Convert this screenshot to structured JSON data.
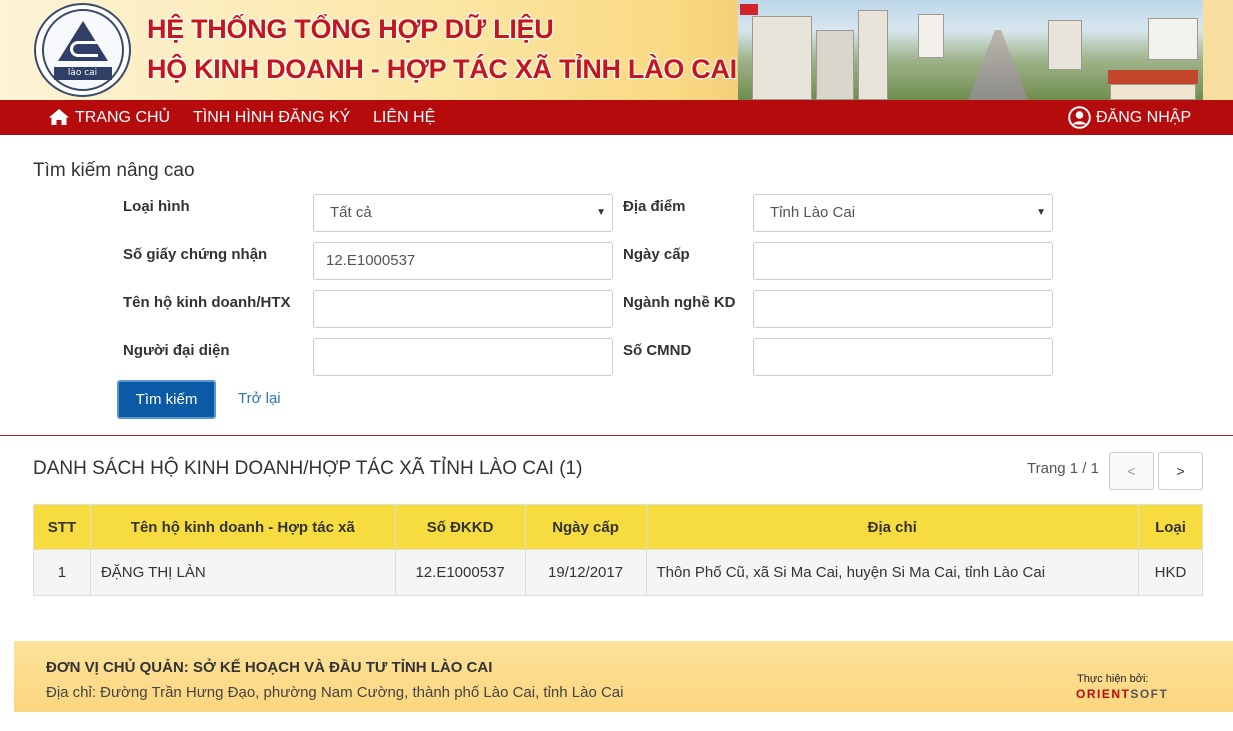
{
  "header": {
    "title_line1": "HỆ THỐNG TỔNG HỢP DỮ LIỆU",
    "title_line2": "HỘ KINH DOANH - HỢP TÁC XÃ TỈNH LÀO CAI",
    "logo_text": "lào cai"
  },
  "nav": {
    "home": "TRANG CHỦ",
    "registration": "TÌNH HÌNH ĐĂNG KÝ",
    "contact": "LIÊN HỆ",
    "login": "ĐĂNG NHẬP"
  },
  "search": {
    "title": "Tìm kiếm nâng cao",
    "type_label": "Loại hình",
    "type_value": "Tất cả",
    "location_label": "Địa điểm",
    "location_value": "Tỉnh Lào Cai",
    "cert_label": "Số giấy chứng nhận",
    "cert_value": "12.E1000537",
    "issue_date_label": "Ngày cấp",
    "issue_date_value": "",
    "name_label": "Tên hộ kinh doanh/HTX",
    "name_value": "",
    "industry_label": "Ngành nghề KD",
    "industry_value": "",
    "rep_label": "Người đại diện",
    "rep_value": "",
    "id_label": "Số CMND",
    "id_value": "",
    "search_button": "Tìm kiếm",
    "back_link": "Trở lại"
  },
  "list": {
    "title": "DANH SÁCH HỘ KINH DOANH/HỢP TÁC XÃ TỈNH LÀO CAI (1)",
    "page_info": "Trang 1 / 1",
    "prev": "<",
    "next": ">",
    "columns": [
      "STT",
      "Tên hộ kinh doanh - Hợp tác xã",
      "Số ĐKKD",
      "Ngày cấp",
      "Địa chỉ",
      "Loại"
    ],
    "rows": [
      [
        "1",
        "ĐẶNG THỊ LÀN",
        "12.E1000537",
        "19/12/2017",
        "Thôn Phố Cũ, xã Si Ma Cai, huyện Si Ma Cai, tỉnh Lào Cai",
        "HKD"
      ]
    ]
  },
  "footer": {
    "owner": "ĐƠN VỊ CHỦ QUẢN: SỞ KẾ HOẠCH VÀ ĐẦU TƯ TỈNH LÀO CAI",
    "address": "Địa chỉ: Đường Trần Hưng Đạo, phường Nam Cường, thành phố Lào Cai, tỉnh Lào Cai",
    "made_by": "Thực hiện bởi:",
    "brand_a": "ORIENT",
    "brand_b": "SOFT"
  },
  "colors": {
    "nav_bg": "#b50b0c",
    "title_red": "#c3171b",
    "table_header": "#f7dc3f",
    "button_blue": "#0b5aa5"
  }
}
